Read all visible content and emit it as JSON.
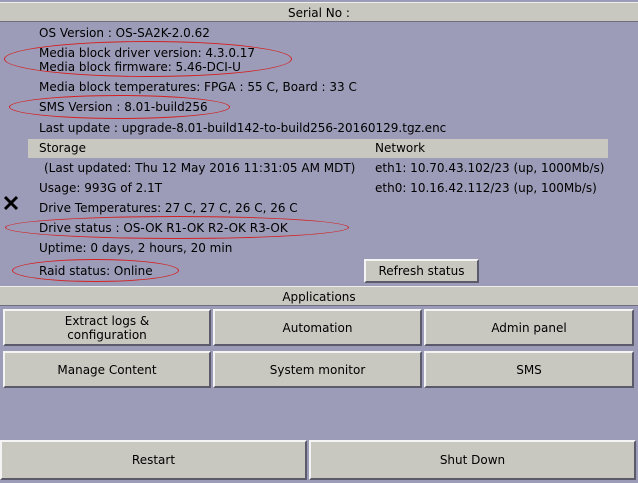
{
  "header": {
    "title": "Serial No :"
  },
  "info": {
    "os_version": "OS Version : OS-SA2K-2.0.62",
    "mb_driver": "Media block driver version: 4.3.0.17",
    "mb_firmware": "Media block firmware: 5.46-DCI-U",
    "mb_temps": "Media block temperatures: FPGA : 55 C, Board : 33 C",
    "sms_version": "SMS Version : 8.01-build256",
    "last_update": "Last update : upgrade-8.01-build142-to-build256-20160129.tgz.enc"
  },
  "storage": {
    "header": "Storage",
    "last_updated": "(Last updated: Thu 12 May 2016 11:31:05 AM MDT)",
    "usage": "Usage: 993G of 2.1T",
    "drive_temps": "Drive Temperatures: 27 C, 27 C, 26 C, 26 C",
    "drive_status": "Drive status : OS-OK  R1-OK  R2-OK  R3-OK",
    "uptime": "Uptime: 0 days, 2 hours, 20 min",
    "raid_status": "Raid status: Online"
  },
  "network": {
    "header": "Network",
    "eth1": "eth1: 10.70.43.102/23 (up, 1000Mb/s)",
    "eth0": "eth0: 10.16.42.112/23 (up, 100Mb/s)"
  },
  "buttons": {
    "refresh": "Refresh status",
    "extract_line1": "Extract logs &",
    "extract_line2": "configuration",
    "automation": "Automation",
    "admin": "Admin panel",
    "manage_content": "Manage Content",
    "system_monitor": "System monitor",
    "sms": "SMS",
    "restart": "Restart",
    "shutdown": "Shut Down"
  },
  "applications": {
    "title": "Applications"
  },
  "colors": {
    "background": "#9c9cb8",
    "panel": "#c8c8c0",
    "annotation": "#d42020"
  },
  "icons": {
    "drive_marker": "x-icon"
  }
}
